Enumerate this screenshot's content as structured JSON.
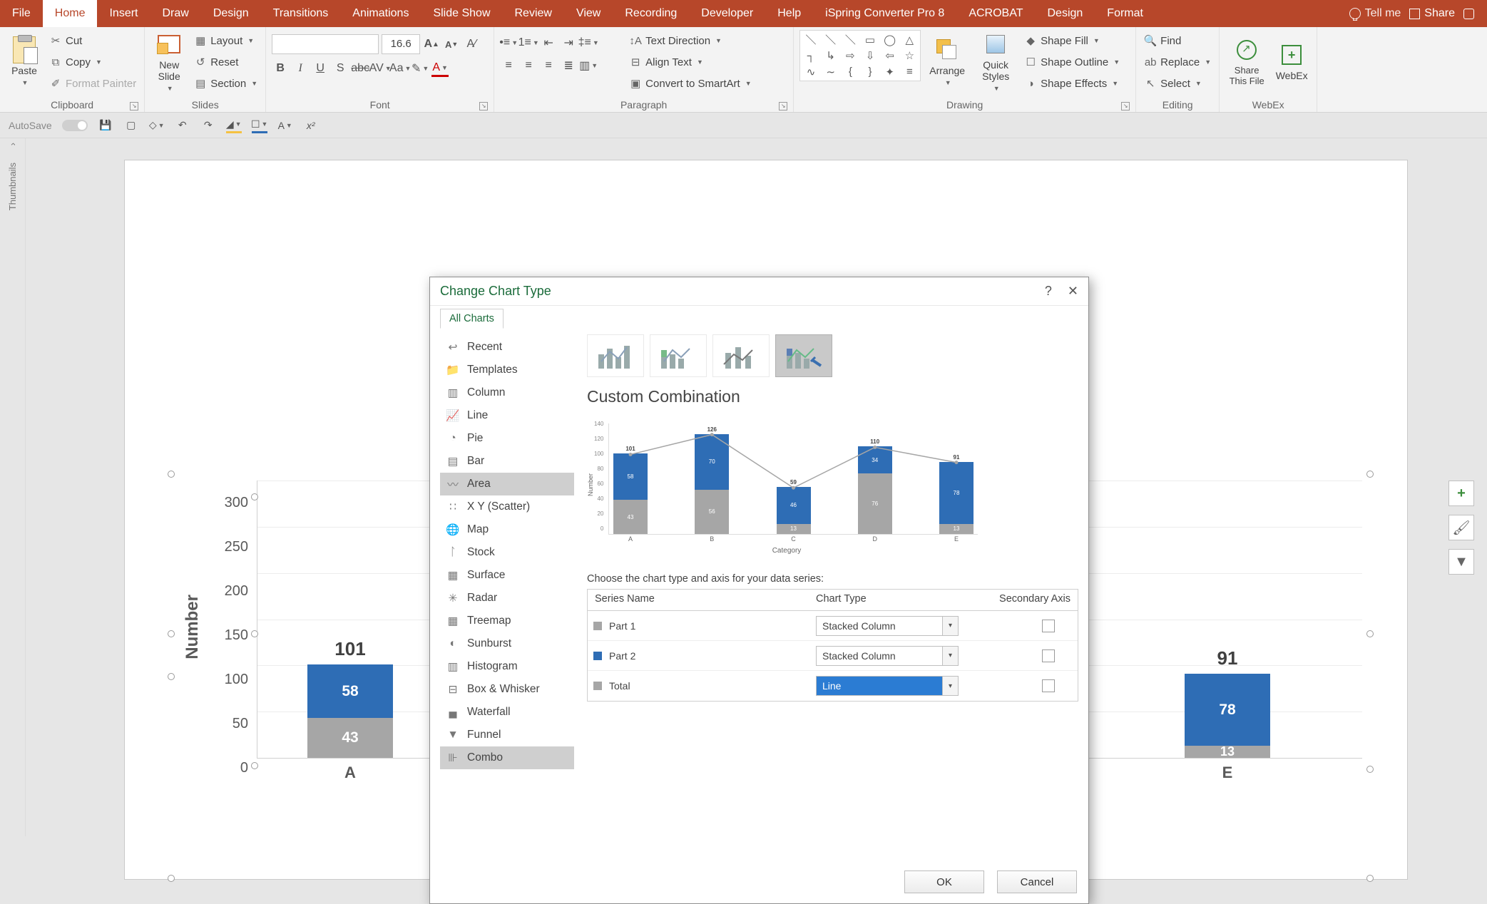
{
  "tabs": {
    "file": "File",
    "home": "Home",
    "insert": "Insert",
    "draw": "Draw",
    "design": "Design",
    "transitions": "Transitions",
    "animations": "Animations",
    "slideshow": "Slide Show",
    "review": "Review",
    "view": "View",
    "recording": "Recording",
    "developer": "Developer",
    "help": "Help",
    "ispring": "iSpring Converter Pro 8",
    "acrobat": "ACROBAT",
    "design2": "Design",
    "format": "Format",
    "tellme": "Tell me",
    "share": "Share"
  },
  "ribbon": {
    "clipboard": {
      "label": "Clipboard",
      "paste": "Paste",
      "cut": "Cut",
      "copy": "Copy",
      "format_painter": "Format Painter"
    },
    "slides": {
      "label": "Slides",
      "new_slide": "New\nSlide",
      "layout": "Layout",
      "reset": "Reset",
      "section": "Section"
    },
    "font": {
      "label": "Font",
      "size": "16.6"
    },
    "paragraph": {
      "label": "Paragraph",
      "text_direction": "Text Direction",
      "align_text": "Align Text",
      "convert_smartart": "Convert to SmartArt"
    },
    "drawing": {
      "label": "Drawing",
      "arrange": "Arrange",
      "quick_styles": "Quick\nStyles",
      "shape_fill": "Shape Fill",
      "shape_outline": "Shape Outline",
      "shape_effects": "Shape Effects"
    },
    "editing": {
      "label": "Editing",
      "find": "Find",
      "replace": "Replace",
      "select": "Select"
    },
    "webex": {
      "label": "WebEx",
      "share_this": "Share\nThis File",
      "webex": "WebEx"
    }
  },
  "qat": {
    "autosave": "AutoSave"
  },
  "dialog": {
    "title": "Change Chart Type",
    "tab": "All Charts",
    "list": [
      "Recent",
      "Templates",
      "Column",
      "Line",
      "Pie",
      "Bar",
      "Area",
      "X Y (Scatter)",
      "Map",
      "Stock",
      "Surface",
      "Radar",
      "Treemap",
      "Sunburst",
      "Histogram",
      "Box & Whisker",
      "Waterfall",
      "Funnel",
      "Combo"
    ],
    "subtype_title": "Custom Combination",
    "series_prompt": "Choose the chart type and axis for your data series:",
    "headers": {
      "name": "Series Name",
      "type": "Chart Type",
      "secondary": "Secondary Axis"
    },
    "series": [
      {
        "name": "Part 1",
        "type": "Stacked Column",
        "swatch": "#a6a6a6",
        "selected": false
      },
      {
        "name": "Part 2",
        "type": "Stacked Column",
        "swatch": "#2e6db5",
        "selected": false
      },
      {
        "name": "Total",
        "type": "Line",
        "swatch": "#a6a6a6",
        "selected": true
      }
    ],
    "ok": "OK",
    "cancel": "Cancel"
  },
  "chart_data": {
    "type": "stacked-bar-with-line",
    "ytitle": "Number",
    "xtitle": "Category",
    "categories": [
      "A",
      "B",
      "C",
      "D",
      "E"
    ],
    "series": [
      {
        "name": "Part 1",
        "values": [
          43,
          56,
          13,
          76,
          13
        ],
        "color": "#a6a6a6"
      },
      {
        "name": "Part 2",
        "values": [
          58,
          70,
          46,
          34,
          78
        ],
        "color": "#2e6db5"
      }
    ],
    "totals": [
      101,
      126,
      59,
      110,
      91
    ],
    "ylim": [
      0,
      300
    ],
    "yticks": [
      0,
      50,
      100,
      150,
      200,
      250,
      300
    ],
    "preview_ylim": [
      0,
      140
    ],
    "preview_yticks": [
      0,
      20,
      40,
      60,
      80,
      100,
      120,
      140
    ]
  },
  "thumbnails": {
    "label": "Thumbnails"
  }
}
